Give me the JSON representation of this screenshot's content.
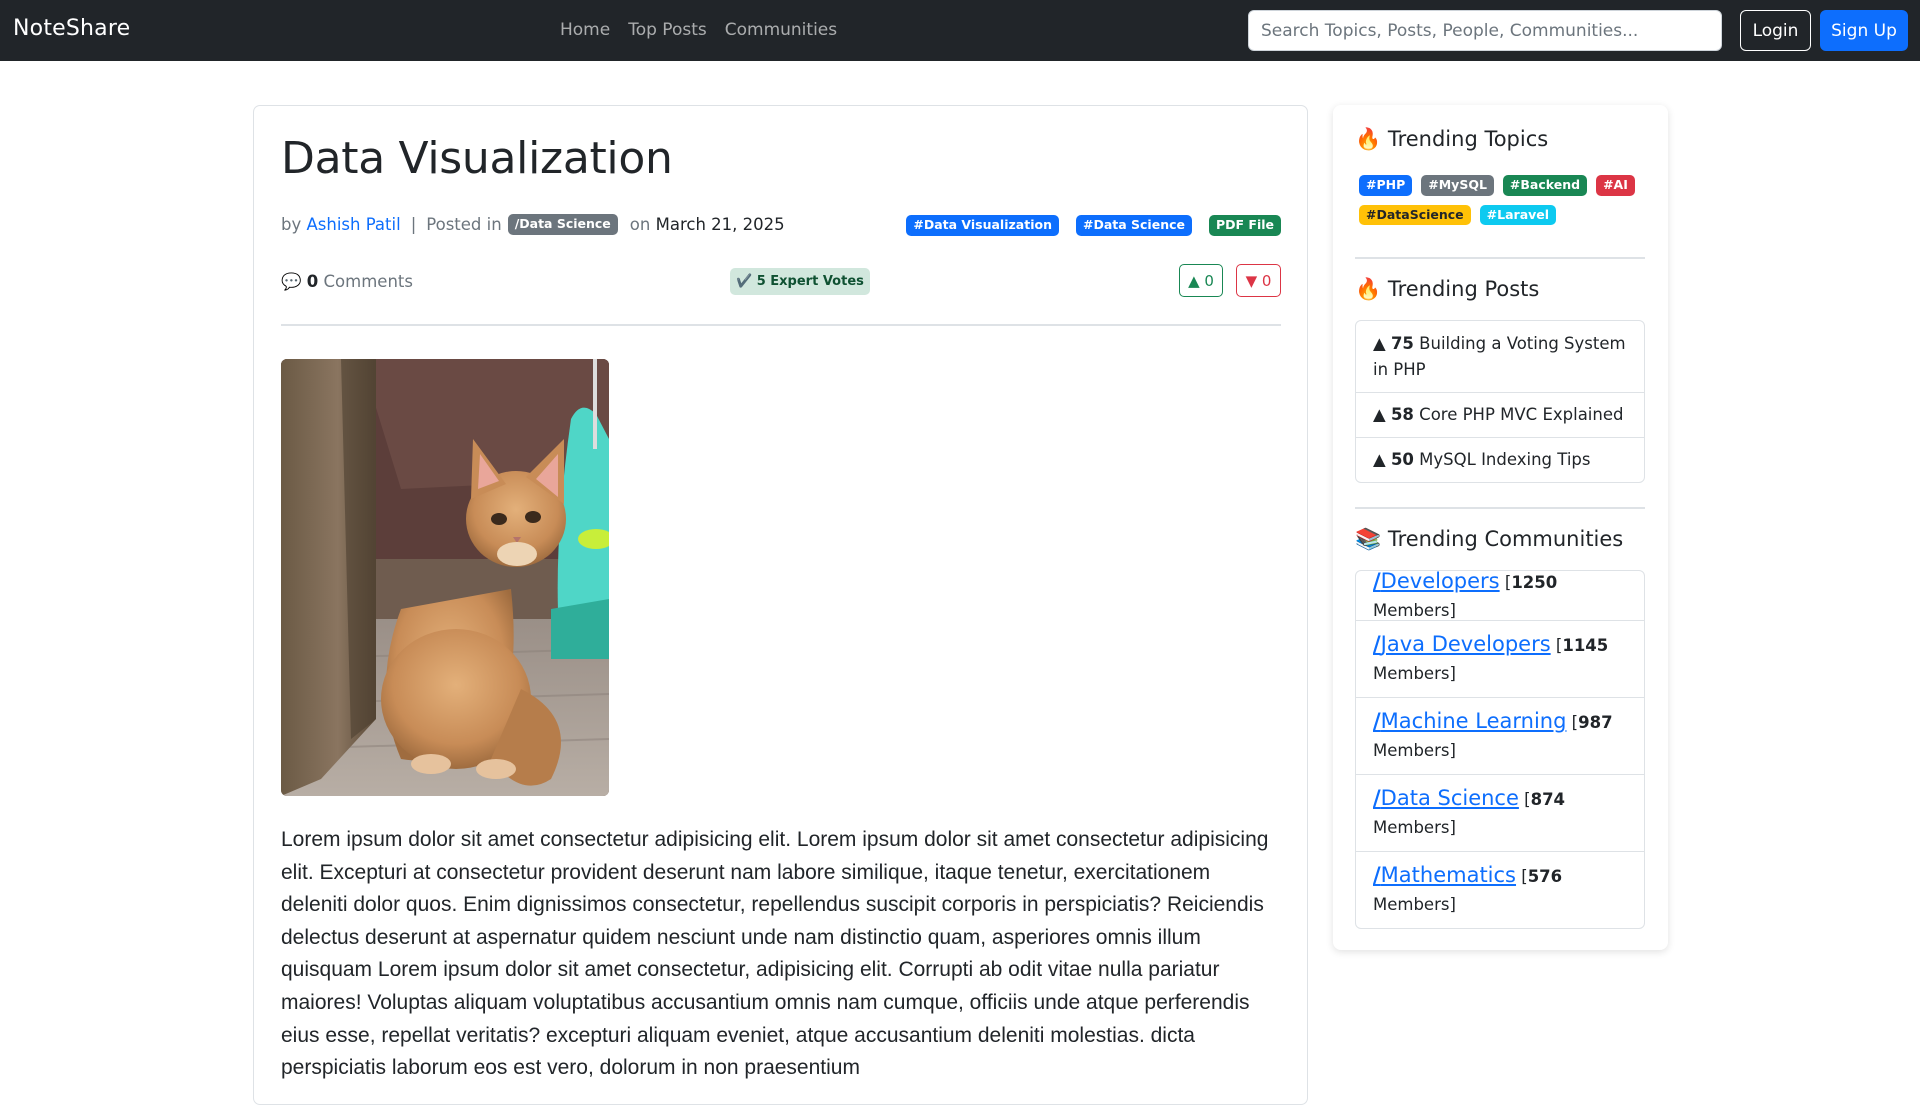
{
  "nav": {
    "brand": "NoteShare",
    "links": [
      "Home",
      "Top Posts",
      "Communities"
    ],
    "search_placeholder": "Search Topics, Posts, People, Communities...",
    "login": "Login",
    "signup": "Sign Up"
  },
  "post": {
    "title": "Data Visualization",
    "by_label": "by",
    "author": "Ashish Patil",
    "posted_in_label": "Posted in",
    "category": "/Data Science",
    "on_label": "on",
    "date": "March 21, 2025",
    "tags": [
      "#Data Visualization",
      "#Data Science",
      "PDF File"
    ],
    "comments_icon": "💬",
    "comments_count": "0",
    "comments_label": "Comments",
    "expert_votes": "✔️ 5 Expert Votes",
    "upvotes": "▲ 0",
    "downvotes": "▼ 0",
    "body": "Lorem ipsum dolor sit amet consectetur adipisicing elit. Lorem ipsum dolor sit amet consectetur adipisicing elit. Excepturi at consectetur provident deserunt nam labore similique, itaque tenetur, exercitationem deleniti dolor quos. Enim dignissimos consectetur, repellendus suscipit corporis in perspiciatis? Reiciendis delectus deserunt at aspernatur quidem nesciunt unde nam distinctio quam, asperiores omnis illum quisquam Lorem ipsum dolor sit amet consectetur, adipisicing elit. Corrupti ab odit vitae nulla pariatur maiores! Voluptas aliquam voluptatibus accusantium omnis nam cumque, officiis unde atque perferendis eius esse, repellat veritatis? excepturi aliquam eveniet, atque accusantium deleniti molestias. dicta perspiciatis laborum eos est vero, dolorum in non praesentium"
  },
  "sidebar": {
    "trending_topics_title": "🔥 Trending Topics",
    "topics": [
      "#PHP",
      "#MySQL",
      "#Backend",
      "#AI",
      "#DataScience",
      "#Laravel"
    ],
    "trending_posts_title": "🔥 Trending Posts",
    "posts": [
      {
        "arrow": "▲",
        "votes": "75",
        "title": "Building a Voting System in PHP"
      },
      {
        "arrow": "▲",
        "votes": "58",
        "title": "Core PHP MVC Explained"
      },
      {
        "arrow": "▲",
        "votes": "50",
        "title": "MySQL Indexing Tips"
      }
    ],
    "trending_communities_title": "📚 Trending Communities",
    "communities": [
      {
        "name": "Developers",
        "members": "1250",
        "members_label": "Members]"
      },
      {
        "name": "Java Developers",
        "members": "1145",
        "members_label": "Members]"
      },
      {
        "name": "Machine Learning",
        "members": "987",
        "members_label": "Members]"
      },
      {
        "name": "Data Science",
        "members": "874",
        "members_label": "Members]"
      },
      {
        "name": "Mathematics",
        "members": "576",
        "members_label": "Members]"
      }
    ]
  },
  "colors": {
    "navbar_bg": "#212529",
    "primary": "#0d6efd",
    "success": "#198754",
    "danger": "#dc3545",
    "secondary": "#6c757d",
    "warning": "#ffc107",
    "info": "#0dcaf0"
  }
}
